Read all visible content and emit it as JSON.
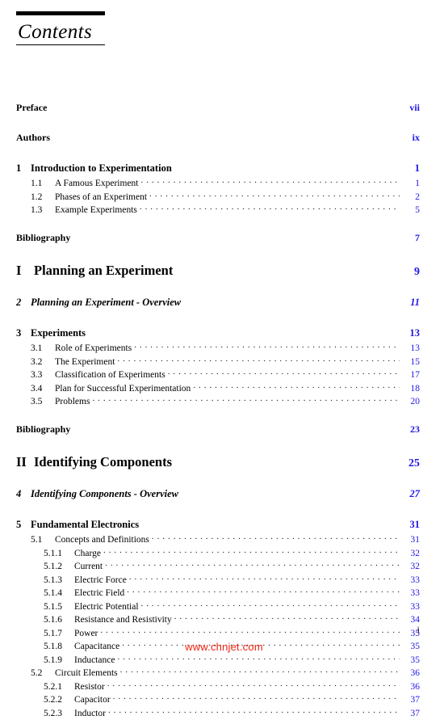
{
  "title": "Contents",
  "folio": "i",
  "watermark": "www.chnjet.com",
  "colors": {
    "page_number": "#2018e8",
    "text": "#000000",
    "watermark": "#ee2211"
  },
  "entries": [
    {
      "type": "front",
      "num": "",
      "label": "Preface",
      "page": "vii",
      "dots": false
    },
    {
      "type": "front",
      "num": "",
      "label": "Authors",
      "page": "ix",
      "dots": false
    },
    {
      "type": "chapter",
      "num": "1",
      "label": "Introduction to Experimentation",
      "page": "1",
      "dots": false
    },
    {
      "type": "section",
      "num": "1.1",
      "label": "A Famous Experiment",
      "page": "1",
      "dots": true
    },
    {
      "type": "section",
      "num": "1.2",
      "label": "Phases of an Experiment",
      "page": "2",
      "dots": true
    },
    {
      "type": "section",
      "num": "1.3",
      "label": "Example Experiments",
      "page": "5",
      "dots": true
    },
    {
      "type": "front",
      "num": "",
      "label": "Bibliography",
      "page": "7",
      "dots": false
    },
    {
      "type": "part",
      "num": "I",
      "label": "Planning an Experiment",
      "page": "9",
      "dots": false
    },
    {
      "type": "chapter-it",
      "num": "2",
      "label": "Planning an Experiment - Overview",
      "page": "11",
      "dots": false
    },
    {
      "type": "chapter",
      "num": "3",
      "label": "Experiments",
      "page": "13",
      "dots": false
    },
    {
      "type": "section",
      "num": "3.1",
      "label": "Role of Experiments",
      "page": "13",
      "dots": true
    },
    {
      "type": "section",
      "num": "3.2",
      "label": "The Experiment",
      "page": "15",
      "dots": true
    },
    {
      "type": "section",
      "num": "3.3",
      "label": "Classification of Experiments",
      "page": "17",
      "dots": true
    },
    {
      "type": "section",
      "num": "3.4",
      "label": "Plan for Successful Experimentation",
      "page": "18",
      "dots": true
    },
    {
      "type": "section",
      "num": "3.5",
      "label": "Problems",
      "page": "20",
      "dots": true
    },
    {
      "type": "front",
      "num": "",
      "label": "Bibliography",
      "page": "23",
      "dots": false
    },
    {
      "type": "part",
      "num": "II",
      "label": "Identifying Components",
      "page": "25",
      "dots": false
    },
    {
      "type": "chapter-it",
      "num": "4",
      "label": "Identifying Components - Overview",
      "page": "27",
      "dots": false
    },
    {
      "type": "chapter",
      "num": "5",
      "label": "Fundamental Electronics",
      "page": "31",
      "dots": false
    },
    {
      "type": "section",
      "num": "5.1",
      "label": "Concepts and Definitions",
      "page": "31",
      "dots": true
    },
    {
      "type": "subsection",
      "num": "5.1.1",
      "label": "Charge",
      "page": "32",
      "dots": true
    },
    {
      "type": "subsection",
      "num": "5.1.2",
      "label": "Current",
      "page": "32",
      "dots": true
    },
    {
      "type": "subsection",
      "num": "5.1.3",
      "label": "Electric Force",
      "page": "33",
      "dots": true
    },
    {
      "type": "subsection",
      "num": "5.1.4",
      "label": "Electric Field",
      "page": "33",
      "dots": true
    },
    {
      "type": "subsection",
      "num": "5.1.5",
      "label": "Electric Potential",
      "page": "33",
      "dots": true
    },
    {
      "type": "subsection",
      "num": "5.1.6",
      "label": "Resistance and Resistivity",
      "page": "34",
      "dots": true
    },
    {
      "type": "subsection",
      "num": "5.1.7",
      "label": "Power",
      "page": "35",
      "dots": true
    },
    {
      "type": "subsection",
      "num": "5.1.8",
      "label": "Capacitance",
      "page": "35",
      "dots": true
    },
    {
      "type": "subsection",
      "num": "5.1.9",
      "label": "Inductance",
      "page": "35",
      "dots": true
    },
    {
      "type": "section",
      "num": "5.2",
      "label": "Circuit Elements",
      "page": "36",
      "dots": true
    },
    {
      "type": "subsection",
      "num": "5.2.1",
      "label": "Resistor",
      "page": "36",
      "dots": true
    },
    {
      "type": "subsection",
      "num": "5.2.2",
      "label": "Capacitor",
      "page": "37",
      "dots": true
    },
    {
      "type": "subsection",
      "num": "5.2.3",
      "label": "Inductor",
      "page": "37",
      "dots": true
    }
  ]
}
